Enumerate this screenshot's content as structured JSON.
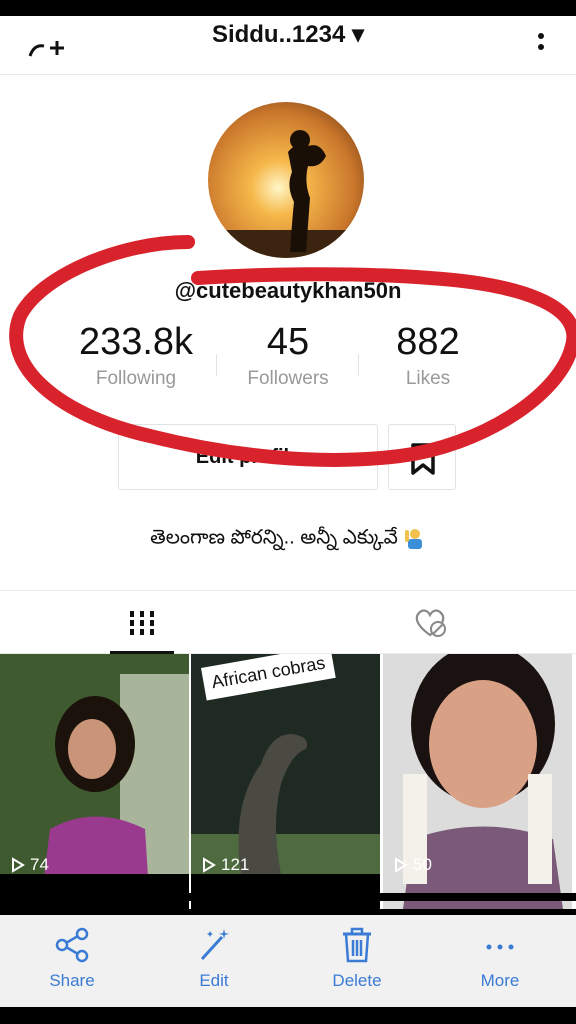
{
  "header": {
    "username": "Siddu..1234 ▾"
  },
  "profile": {
    "handle": "@cutebeautykhan50n",
    "edit_button_label": "Edit profile",
    "bio": "తెలంగాణ పోరన్ని.. అన్నీ ఎక్కువే"
  },
  "stats": [
    {
      "value": "233.8k",
      "label": "Following"
    },
    {
      "value": "45",
      "label": "Followers"
    },
    {
      "value": "882",
      "label": "Likes"
    }
  ],
  "videos": [
    {
      "plays": "74",
      "caption": ""
    },
    {
      "plays": "121",
      "caption": "African cobras"
    },
    {
      "plays": "50",
      "caption": ""
    }
  ],
  "actions": [
    {
      "label": "Share",
      "icon": "share-icon"
    },
    {
      "label": "Edit",
      "icon": "magic-wand-icon"
    },
    {
      "label": "Delete",
      "icon": "trash-icon"
    },
    {
      "label": "More",
      "icon": "more-icon"
    }
  ],
  "colors": {
    "accent": "#3a7bd5",
    "annotation": "#d9232c"
  }
}
